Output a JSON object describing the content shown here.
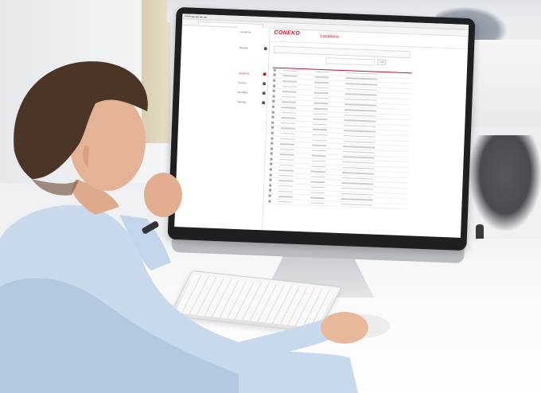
{
  "scene": {
    "type": "photo",
    "subject": "man at desktop computer",
    "accent_color": "#c8102e"
  },
  "screen": {
    "logo": "CONEKO",
    "page_title": "Locations",
    "sidebar_items": [
      {
        "label": "Locations",
        "active": false
      },
      {
        "label": "Reports",
        "active": false
      },
      {
        "label": "Locations",
        "active": true
      },
      {
        "label": "Groups",
        "active": false
      },
      {
        "label": "Members",
        "active": false
      },
      {
        "label": "Settings",
        "active": false
      }
    ],
    "button_label": "Add",
    "table_columns": [
      "",
      "",
      "",
      ""
    ],
    "row_count": 26
  }
}
